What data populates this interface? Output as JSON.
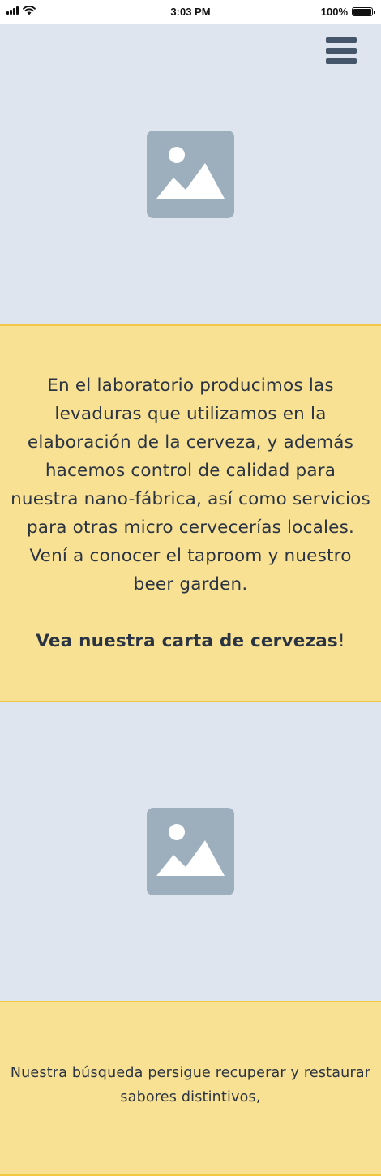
{
  "status_bar": {
    "time": "3:03 PM",
    "battery": "100%"
  },
  "header": {
    "menu_icon": "hamburger-menu-icon"
  },
  "hero": {
    "image_icon": "image-placeholder-icon"
  },
  "intro": {
    "paragraph": "En el laboratorio producimos las levaduras que utilizamos en la elaboración de la cerveza, y además hacemos control de calidad para nuestra nano-fábrica, así como servicios para otras micro cervecerías locales. Vení a conocer el taproom y nuestro beer garden.",
    "cta_link": "Vea nuestra carta de cervezas",
    "cta_suffix": "!"
  },
  "gallery": {
    "image_icon": "image-placeholder-icon"
  },
  "mission": {
    "paragraph": "Nuestra búsqueda persigue recuperar y restaurar sabores distintivos,"
  },
  "colors": {
    "hero_bg": "#dfe5ee",
    "text_block_bg": "#f9e194",
    "text_block_border": "#f2c744",
    "placeholder": "#9daebc",
    "menu_icon": "#45556a",
    "text": "#2a3442"
  }
}
